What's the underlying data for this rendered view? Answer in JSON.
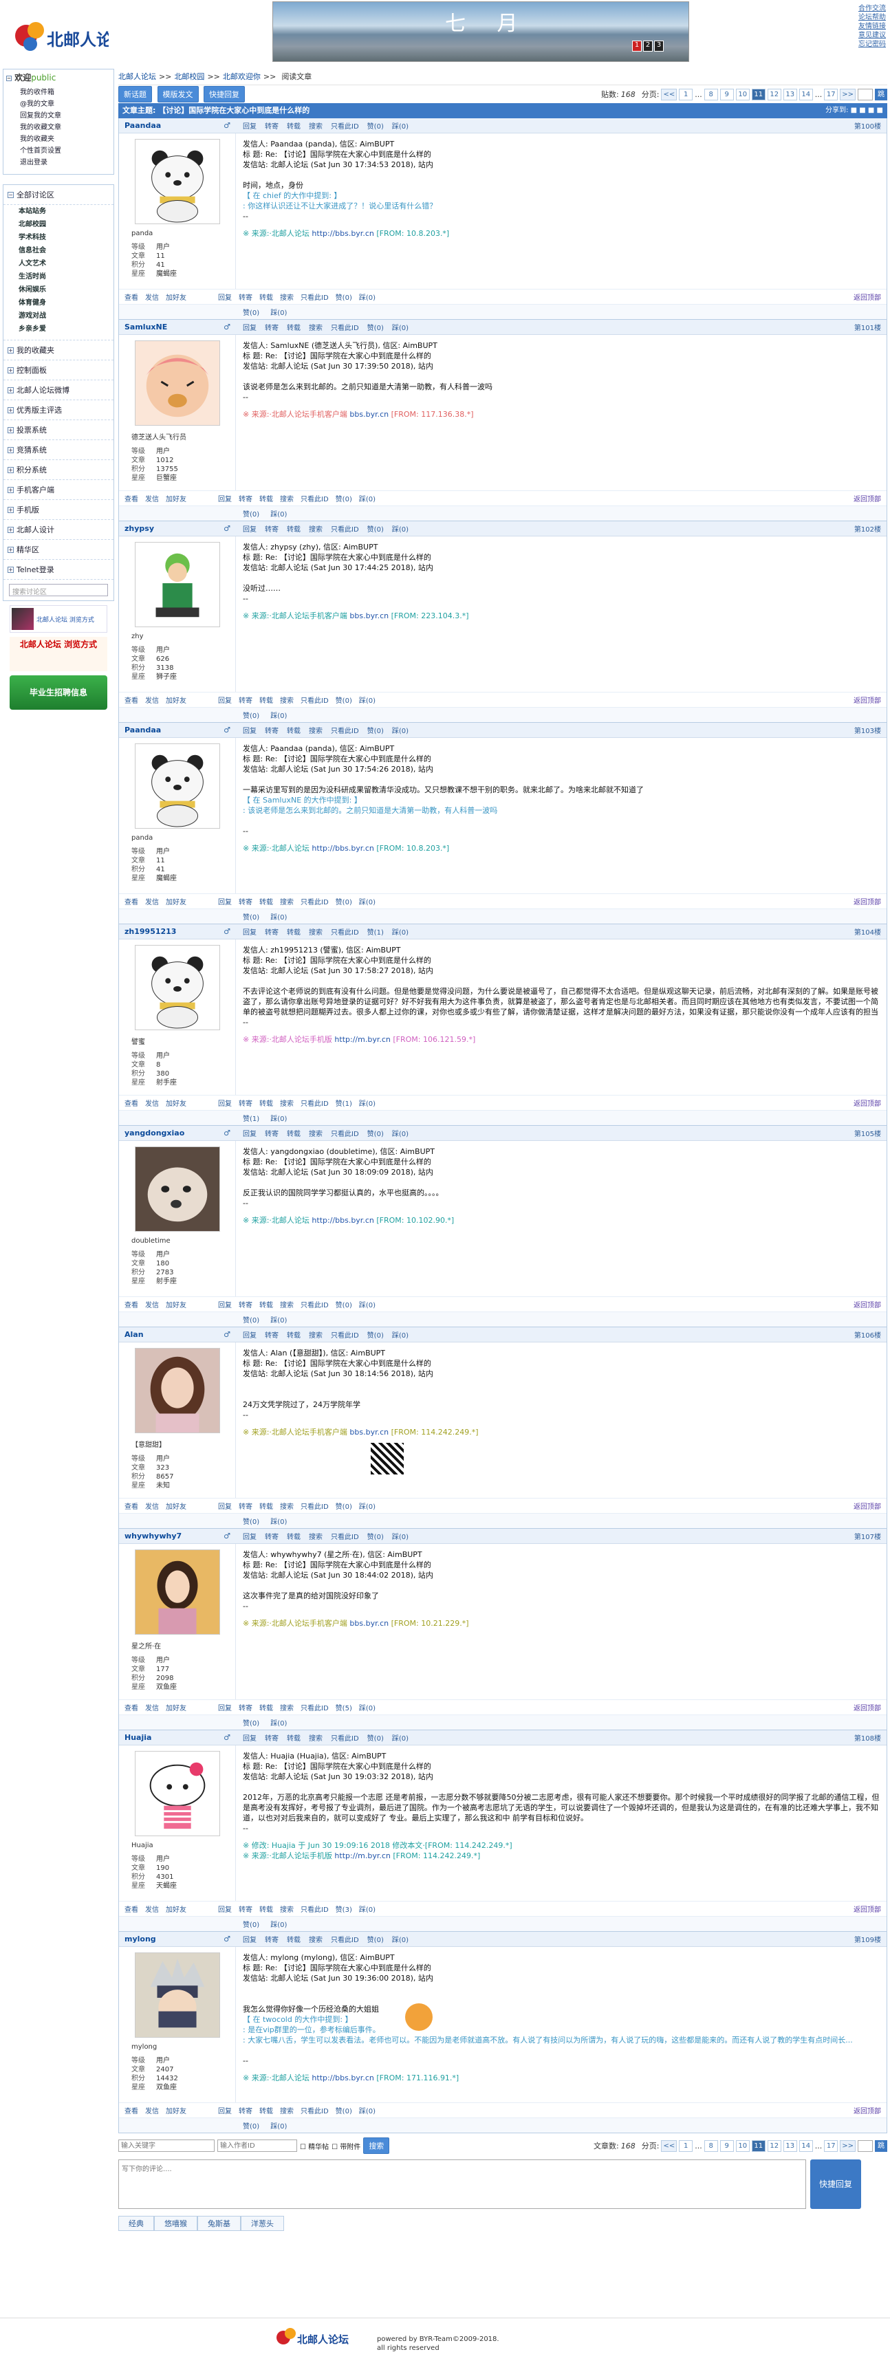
{
  "header": {
    "logo_text": "北邮人论坛",
    "banner_text": "七 月",
    "banner_pages": [
      "1",
      "2",
      "3"
    ],
    "top_links": [
      "合作交流",
      "论坛帮助",
      "友情链接",
      "意见建议",
      "忘记密码"
    ]
  },
  "sidebar": {
    "welcome": "欢迎",
    "user": "public",
    "user_links": [
      "我的收件箱",
      "@我的文章",
      "回复我的文章",
      "我的收藏文章",
      "我的收藏夹",
      "个性首页设置",
      "退出登录"
    ],
    "board_title": "全部讨论区",
    "boards": [
      "本站站务",
      "北邮校园",
      "学术科技",
      "信息社会",
      "人文艺术",
      "生活时尚",
      "休闲娱乐",
      "体育健身",
      "游戏对战",
      "乡亲乡爱"
    ],
    "sections": [
      "我的收藏夹",
      "控制面板",
      "北邮人论坛微博",
      "优秀版主评选",
      "投票系统",
      "竞猜系统",
      "积分系统",
      "手机客户端",
      "手机版",
      "北邮人设计",
      "精华区",
      "Telnet登录"
    ],
    "search_placeholder": "搜索讨论区",
    "ads": [
      "北邮人论坛 浏览方式",
      "毕业生招聘信息"
    ]
  },
  "breadcrumb": [
    "北邮人论坛",
    ">>",
    "北邮校园",
    ">>",
    "北邮欢迎你",
    ">>",
    "阅读文章"
  ],
  "toolbar": {
    "new": "新话题",
    "tpl": "模版发文",
    "quick": "快捷回复",
    "post_count_label": "贴数:",
    "post_count": "168",
    "page_label": "分页:"
  },
  "pager": [
    "<<",
    "1",
    "...",
    "8",
    "9",
    "10",
    "11",
    "12",
    "13",
    "14",
    "...",
    "17",
    ">>"
  ],
  "pager_current": "11",
  "subject": {
    "text": "文章主题: 【讨论】国际学院在大家心中到底是什么样的",
    "share": "分享到:"
  },
  "actions": {
    "reply": "回复",
    "forward": "转寄",
    "cross": "转载",
    "search": "搜索",
    "only": "只看此ID",
    "like": "赞",
    "dislike": "踩",
    "view": "查看",
    "mail": "发信",
    "friend": "加好友",
    "back": "返回顶部"
  },
  "stat_labels": {
    "level": "等级",
    "posts": "文章",
    "score": "积分",
    "sign": "星座"
  },
  "posts": [
    {
      "id": "Paandaa",
      "nick": "panda",
      "level": "用户",
      "posts": "11",
      "score": "41",
      "sign": "魔蝎座",
      "floor": "第100楼",
      "like": "0",
      "dislike": "0",
      "like2": "0",
      "dislike2": "0",
      "lines": [
        "发信人: Paandaa (panda), 信区: AimBUPT",
        "标  题: Re: 【讨论】国际学院在大家心中到底是什么样的",
        "发信站: 北邮人论坛 (Sat Jun 30 17:34:53 2018), 站内",
        "",
        "时间，地点，身份"
      ],
      "quote": [
        "【 在 chief 的大作中提到: 】",
        ": 你这样认识还让不让大家进成了？！说心里话有什么错？"
      ],
      "after": [
        "--"
      ],
      "src_pre": "※ 来源:·北邮人论坛 ",
      "src_link": "http://bbs.byr.cn",
      "src_post": " [FROM: 10.8.203.*]",
      "src_color": "#20a0a0",
      "avatar": "bear"
    },
    {
      "id": "SamluxNE",
      "nick": "德芝送人头飞行员",
      "level": "用户",
      "posts": "1012",
      "score": "13755",
      "sign": "巨蟹座",
      "floor": "第101楼",
      "like": "0",
      "dislike": "0",
      "like2": "0",
      "dislike2": "0",
      "lines": [
        "发信人: SamluxNE (德芝送人头飞行员), 信区: AimBUPT",
        "标  题: Re: 【讨论】国际学院在大家心中到底是什么样的",
        "发信站: 北邮人论坛 (Sat Jun 30 17:39:50 2018), 站内",
        "",
        "该说老师是怎么来到北邮的。之前只知道是大清第一助教，有人科普一波吗",
        "--"
      ],
      "quote": [],
      "after": [],
      "src_pre": "※ 来源:·北邮人论坛手机客户端 ",
      "src_link": "bbs.byr.cn",
      "src_post": " [FROM: 117.136.38.*]",
      "src_color": "#e06060",
      "avatar": "anime"
    },
    {
      "id": "zhypsy",
      "nick": "zhy",
      "level": "用户",
      "posts": "626",
      "score": "3138",
      "sign": "狮子座",
      "floor": "第102楼",
      "like": "0",
      "dislike": "0",
      "like2": "0",
      "dislike2": "0",
      "lines": [
        "发信人: zhypsy (zhy), 信区: AimBUPT",
        "标  题: Re: 【讨论】国际学院在大家心中到底是什么样的",
        "发信站: 北邮人论坛 (Sat Jun 30 17:44:25 2018), 站内",
        "",
        "没听过……",
        "--"
      ],
      "quote": [],
      "after": [],
      "src_pre": "※ 来源:·北邮人论坛手机客户端 ",
      "src_link": "bbs.byr.cn",
      "src_post": " [FROM: 223.104.3.*]",
      "src_color": "#20a0a0",
      "avatar": "zoro"
    },
    {
      "id": "Paandaa",
      "nick": "panda",
      "level": "用户",
      "posts": "11",
      "score": "41",
      "sign": "魔蝎座",
      "floor": "第103楼",
      "like": "0",
      "dislike": "0",
      "like2": "0",
      "dislike2": "0",
      "lines": [
        "发信人: Paandaa (panda), 信区: AimBUPT",
        "标  题: Re: 【讨论】国际学院在大家心中到底是什么样的",
        "发信站: 北邮人论坛 (Sat Jun 30 17:54:26 2018), 站内",
        "",
        "一幕采访里写到的是因为没科研成果留教清华没成功。又只想教课不想干别的职务。就来北邮了。为啥来北邮就不知道了"
      ],
      "quote": [
        "【 在 SamluxNE 的大作中提到: 】",
        ": 该说老师是怎么来到北邮的。之前只知道是大清第一助教，有人科普一波吗"
      ],
      "after": [
        "",
        "--"
      ],
      "src_pre": "※ 来源:·北邮人论坛 ",
      "src_link": "http://bbs.byr.cn",
      "src_post": " [FROM: 10.8.203.*]",
      "src_color": "#20a0a0",
      "avatar": "bear"
    },
    {
      "id": "zh19951213",
      "nick": "譬蜜",
      "level": "用户",
      "posts": "8",
      "score": "380",
      "sign": "射手座",
      "floor": "第104楼",
      "like": "1",
      "dislike": "0",
      "like2": "1",
      "dislike2": "0",
      "lines": [
        "发信人: zh19951213 (譬蜜), 信区: AimBUPT",
        "标  题: Re: 【讨论】国际学院在大家心中到底是什么样的",
        "发信站: 北邮人论坛 (Sat Jun 30 17:58:27 2018), 站内",
        "",
        "不去评论这个老师说的到底有没有什么问题。但是他要是觉得没问题，为什么要说是被逼号了，自己都觉得不太合适吧。但是纵观这聊天记录，前后流畅，对北邮有深刻的了解。如果是账号被盗了，那么请你拿出账号异地登录的证据可好？好不好我有用大为这件事负责，就算是被盗了，那么盗号者肯定也是与北邮相关者。而且同时期应该在其他地方也有类似发言，不要试图一个简单的被盗号就想把问题糊弄过去。很多人都上过你的课，对你也或多或少有些了解，请你做清楚证据，这样才是解决问题的最好方法，如果没有证据，那只能说你没有一个成年人应该有的担当",
        "--"
      ],
      "quote": [],
      "after": [],
      "src_pre": "※ 来源:·北邮人论坛手机版 ",
      "src_link": "http://m.byr.cn",
      "src_post": " [FROM: 106.121.59.*]",
      "src_color": "#d060c0",
      "avatar": "bear"
    },
    {
      "id": "yangdongxiao",
      "nick": "doubletime",
      "level": "用户",
      "posts": "180",
      "score": "2783",
      "sign": "射手座",
      "floor": "第105楼",
      "like": "0",
      "dislike": "0",
      "like2": "0",
      "dislike2": "0",
      "lines": [
        "发信人: yangdongxiao (doubletime), 信区: AimBUPT",
        "标  题: Re: 【讨论】国际学院在大家心中到底是什么样的",
        "发信站: 北邮人论坛 (Sat Jun 30 18:09:09 2018), 站内",
        "",
        "反正我认识的国院同学学习都挺认真的，水平也挺高的。。。。",
        "--"
      ],
      "quote": [],
      "after": [],
      "src_pre": "※ 来源:·北邮人论坛 ",
      "src_link": "http://bbs.byr.cn",
      "src_post": " [FROM: 10.102.90.*]",
      "src_color": "#20a0a0",
      "avatar": "dog"
    },
    {
      "id": "Alan",
      "nick": "【意甜甜】",
      "level": "用户",
      "posts": "323",
      "score": "8657",
      "sign": "未知",
      "floor": "第106楼",
      "like": "0",
      "dislike": "0",
      "like2": "0",
      "dislike2": "0",
      "lines": [
        "发信人: Alan (【意甜甜】), 信区: AimBUPT",
        "标  题: Re: 【讨论】国际学院在大家心中到底是什么样的",
        "发信站: 北邮人论坛 (Sat Jun 30 18:14:56 2018), 站内",
        "",
        "",
        "24万文凭学院过了，24万学院年学"
      ],
      "quote": [],
      "after": [
        "--"
      ],
      "src_pre": "※ 来源:·北邮人论坛手机客户端 ",
      "src_link": "bbs.byr.cn",
      "src_post": " [FROM: 114.242.249.*]",
      "src_color": "#a0a020",
      "avatar": "girl"
    },
    {
      "id": "whywhywhy7",
      "nick": "星之所·在",
      "level": "用户",
      "posts": "177",
      "score": "2098",
      "sign": "双鱼座",
      "floor": "第107楼",
      "like": "0",
      "dislike": "0",
      "like2": "5",
      "dislike2": "0",
      "lines": [
        "发信人: whywhywhy7 (星之所·在), 信区: AimBUPT",
        "标  题: Re: 【讨论】国际学院在大家心中到底是什么样的",
        "发信站: 北邮人论坛 (Sat Jun 30 18:44:02 2018), 站内",
        "",
        "这次事件完了是真的给对国院没好印象了",
        "--"
      ],
      "quote": [],
      "after": [],
      "src_pre": "※ 来源:·北邮人论坛手机客户端 ",
      "src_link": "bbs.byr.cn",
      "src_post": " [FROM: 10.21.229.*]",
      "src_color": "#a0a020",
      "avatar": "girl2"
    },
    {
      "id": "Huajia",
      "nick": "Huajia",
      "level": "用户",
      "posts": "190",
      "score": "4301",
      "sign": "天蝎座",
      "floor": "第108楼",
      "like": "0",
      "dislike": "0",
      "like2": "3",
      "dislike2": "0",
      "lines": [
        "发信人: Huajia (Huajia), 信区: AimBUPT",
        "标  题: Re: 【讨论】国际学院在大家心中到底是什么样的",
        "发信站: 北邮人论坛 (Sat Jun 30 19:03:32 2018), 站内",
        "",
        "2012年，万恶的北京高考只能报一个志愿 还是考前报，一志愿分数不够就要降50分被二志愿考虑，很有可能人家还不想要要你。那个时候我一个平时成绩很好的同学报了北邮的通信工程，但是高考没有发挥好，考号报了专业调剂，最后进了国院。作为一个被高考志愿坑了无语的学生，可以说要调住了一个毁掉坏还调的，但是我认为这是调住的，在有准的比还难大学事上，我不知道，以也对对后我来自的，就可以变成好了 专业。最后上实理了，那么我这和中 前学有目标和位说好。"
      ],
      "quote": [],
      "after": [
        "--"
      ],
      "src_pre": "※ 修改: Huajia 于 Jun 30 19:09:16 2018 修改本文·[FROM: 114.242.249.*]",
      "src_link": "",
      "src_post": "",
      "src_color": "#20a0a0",
      "src2_pre": "※ 来源:·北邮人论坛手机版 ",
      "src2_link": "http://m.byr.cn",
      "src2_post": " [FROM: 114.242.249.*]",
      "avatar": "hellokitty"
    },
    {
      "id": "mylong",
      "nick": "mylong",
      "level": "用户",
      "posts": "2407",
      "score": "14432",
      "sign": "双鱼座",
      "floor": "第109楼",
      "like": "0",
      "dislike": "0",
      "like2": "0",
      "dislike2": "0",
      "lines": [
        "发信人: mylong (mylong), 信区: AimBUPT",
        "标  题: Re: 【讨论】国际学院在大家心中到底是什么样的",
        "发信站: 北邮人论坛 (Sat Jun 30 19:36:00 2018), 站内",
        "",
        "",
        "我怎么觉得你好像一个历经沧桑的大姐姐"
      ],
      "quote": [
        "【 在 twocold 的大作中提到: 】",
        ": 是在vip群里的一位，参考标编后事件。",
        ": 大家七嘴八舌，学生可以发表看法。老师也可以。不能因为是老师就道高不放。有人说了有技问以为所谓为，有人说了玩的嗨，这些都是能来的。而还有人说了教的学生有点时间长..."
      ],
      "after": [
        "",
        "--"
      ],
      "src_pre": "※ 来源:·北邮人论坛 ",
      "src_link": "http://bbs.byr.cn",
      "src_post": " [FROM: 171.116.91.*]",
      "src_color": "#20a0a0",
      "avatar": "kakashi"
    }
  ],
  "bottom": {
    "search_ph": "输入关键字",
    "author_ph": "输入作者ID",
    "essence": "精华帖",
    "attach": "带附件",
    "go": "搜索",
    "post_count_label": "文章数:",
    "post_count": "168"
  },
  "reply": {
    "placeholder": "写下你的评论....",
    "button": "快捷回复",
    "emotes": [
      "经典",
      "悠嘻猴",
      "兔斯基",
      "洋葱头"
    ]
  },
  "footer": {
    "logo": "北邮人论坛",
    "line1": "powered by BYR-Team©2009-2018.",
    "line2": "all rights reserved"
  },
  "colors": {
    "accent": "#3c79c5",
    "brand_red": "#d2232a"
  }
}
